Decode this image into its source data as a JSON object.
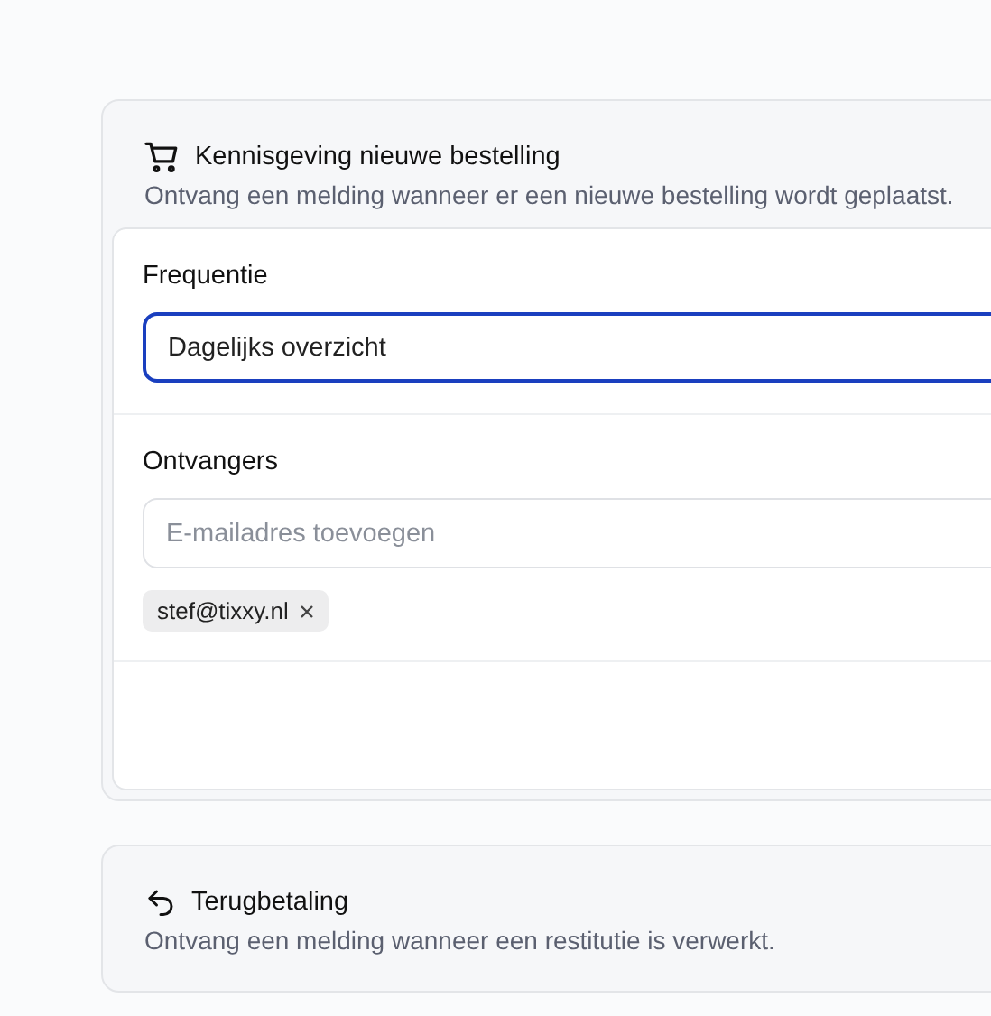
{
  "cards": [
    {
      "kind": "order",
      "title": "Kennisgeving nieuwe bestelling",
      "description": "Ontvang een melding wanneer er een nieuwe bestelling wordt geplaatst.",
      "expanded": true,
      "frequency": {
        "label": "Frequentie",
        "value": "Dagelijks overzicht",
        "focused": true
      },
      "recipients": {
        "label": "Ontvangers",
        "placeholder": "E-mailadres toevoegen",
        "chips": [
          "stef@tixxy.nl"
        ]
      }
    },
    {
      "kind": "refund",
      "title": "Terugbetaling",
      "description": "Ontvang een melding wanneer een restitutie is verwerkt.",
      "expanded": false
    }
  ]
}
